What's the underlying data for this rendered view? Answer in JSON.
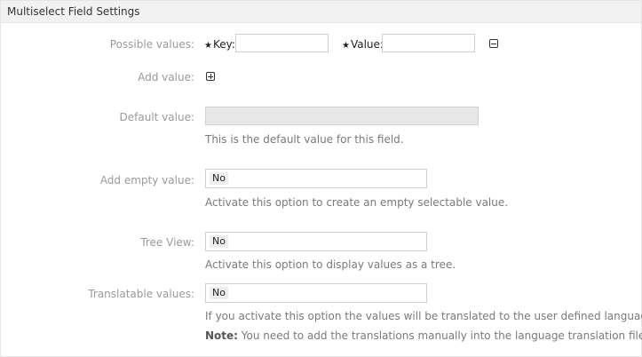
{
  "panel": {
    "title": "Multiselect Field Settings"
  },
  "possible_values": {
    "label": "Possible values:",
    "required_marker": "★",
    "key_label": "Key:",
    "value_label": "Value:",
    "key_value": "",
    "value_value": ""
  },
  "add_value": {
    "label": "Add value:"
  },
  "default_value": {
    "label": "Default value:",
    "value": "",
    "hint": "This is the default value for this field."
  },
  "add_empty_value": {
    "label": "Add empty value:",
    "selected": "No",
    "hint": "Activate this option to create an empty selectable value."
  },
  "tree_view": {
    "label": "Tree View:",
    "selected": "No",
    "hint": "Activate this option to display values as a tree."
  },
  "translatable_values": {
    "label": "Translatable values:",
    "selected": "No",
    "hint": "If you activate this option the values will be translated to the user defined language.",
    "note_label": "Note:",
    "note_text": " You need to add the translations manually into the language translation files."
  }
}
